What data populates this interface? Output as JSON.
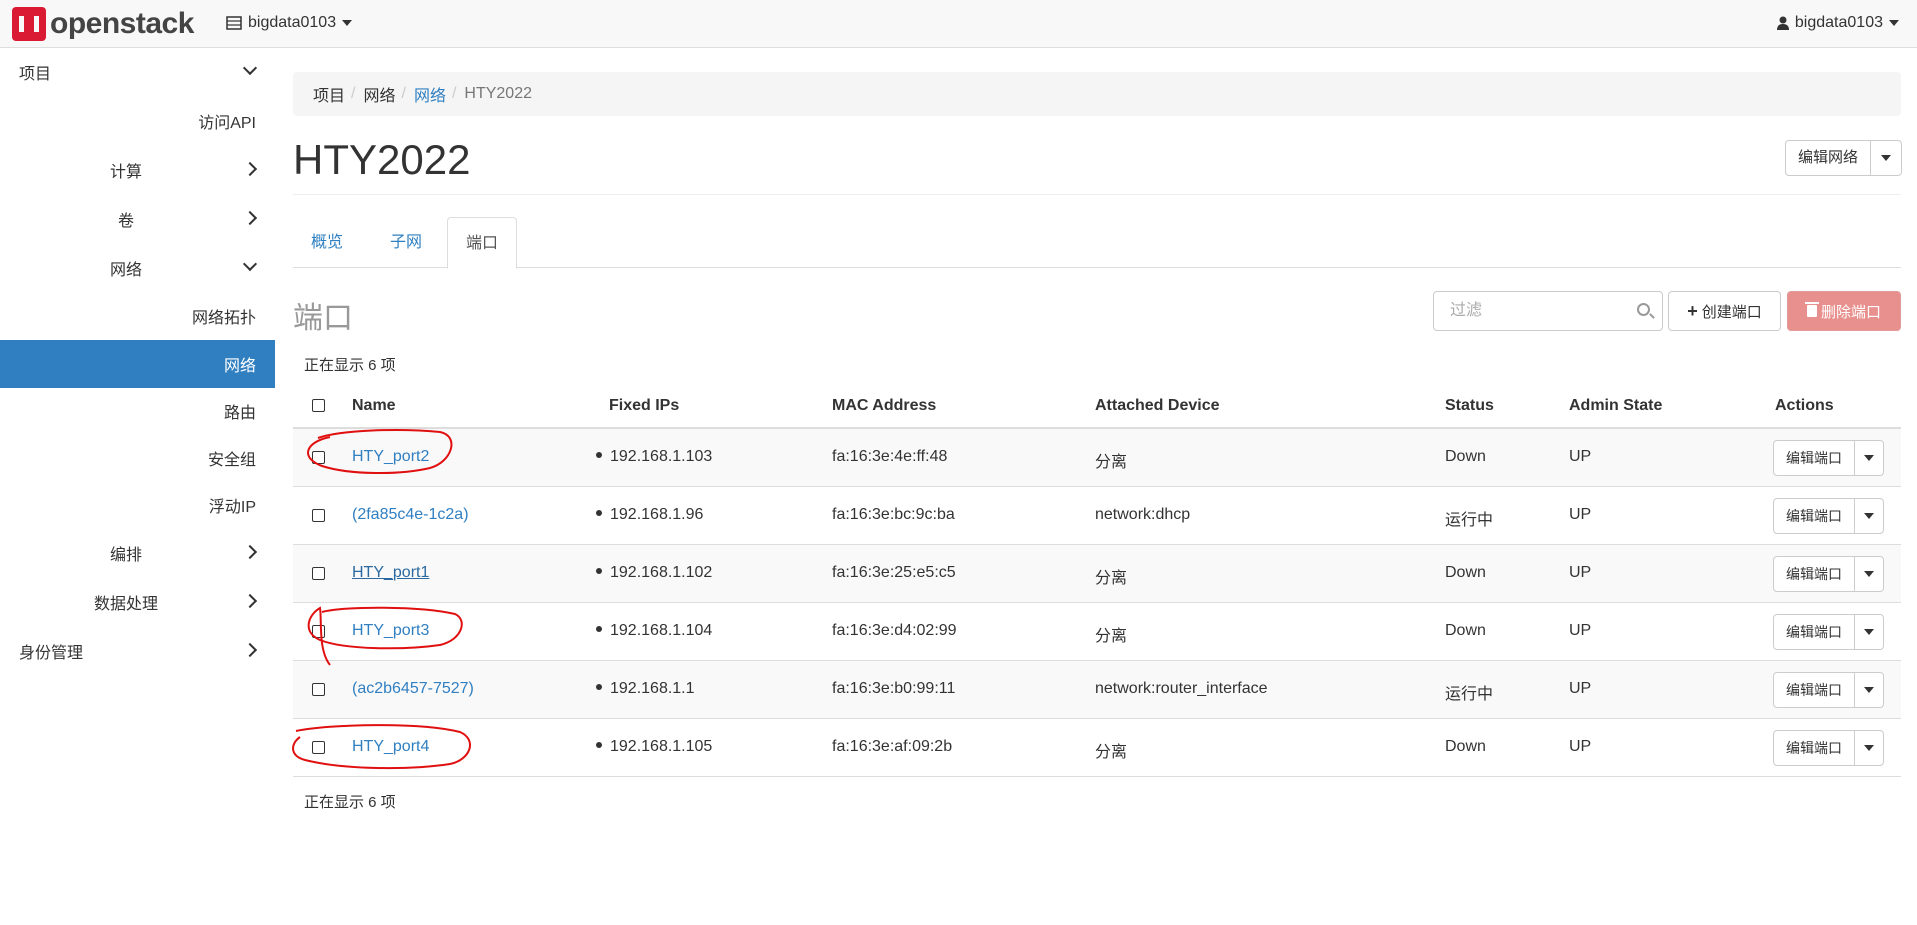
{
  "topbar": {
    "brand": "openstack",
    "project_selector": "bigdata0103",
    "user_menu": "bigdata0103"
  },
  "sidebar": {
    "items": [
      {
        "label": "项目"
      },
      {
        "label": "访问API"
      },
      {
        "label": "计算"
      },
      {
        "label": "卷"
      },
      {
        "label": "网络"
      },
      {
        "label": "网络拓扑"
      },
      {
        "label": "网络"
      },
      {
        "label": "路由"
      },
      {
        "label": "安全组"
      },
      {
        "label": "浮动IP"
      },
      {
        "label": "编排"
      },
      {
        "label": "数据处理"
      },
      {
        "label": "身份管理"
      }
    ]
  },
  "breadcrumb": {
    "items": [
      "项目",
      "网络",
      "网络",
      "HTY2022"
    ],
    "separator": "/"
  },
  "page": {
    "title": "HTY2022",
    "edit_button": "编辑网络"
  },
  "tabs": [
    "概览",
    "子网",
    "端口"
  ],
  "ports": {
    "section_title": "端口",
    "filter_placeholder": "过滤",
    "create_button": "创建端口",
    "delete_button": "删除端口",
    "count_text": "正在显示 6 项",
    "columns": [
      "Name",
      "Fixed IPs",
      "MAC Address",
      "Attached Device",
      "Status",
      "Admin State",
      "Actions"
    ],
    "rows": [
      {
        "name": "HTY_port2",
        "ip": "192.168.1.103",
        "mac": "fa:16:3e:4e:ff:48",
        "device": "分离",
        "status": "Down",
        "admin": "UP",
        "action": "编辑端口"
      },
      {
        "name": "(2fa85c4e-1c2a)",
        "ip": "192.168.1.96",
        "mac": "fa:16:3e:bc:9c:ba",
        "device": "network:dhcp",
        "status": "运行中",
        "admin": "UP",
        "action": "编辑端口"
      },
      {
        "name": "HTY_port1",
        "ip": "192.168.1.102",
        "mac": "fa:16:3e:25:e5:c5",
        "device": "分离",
        "status": "Down",
        "admin": "UP",
        "action": "编辑端口"
      },
      {
        "name": "HTY_port3",
        "ip": "192.168.1.104",
        "mac": "fa:16:3e:d4:02:99",
        "device": "分离",
        "status": "Down",
        "admin": "UP",
        "action": "编辑端口"
      },
      {
        "name": "(ac2b6457-7527)",
        "ip": "192.168.1.1",
        "mac": "fa:16:3e:b0:99:11",
        "device": "network:router_interface",
        "status": "运行中",
        "admin": "UP",
        "action": "编辑端口"
      },
      {
        "name": "HTY_port4",
        "ip": "192.168.1.105",
        "mac": "fa:16:3e:af:09:2b",
        "device": "分离",
        "status": "Down",
        "admin": "UP",
        "action": "编辑端口"
      }
    ]
  },
  "colors": {
    "accent": "#2f7fc1",
    "brand": "#da1a32",
    "danger": "#e8908e",
    "annotation": "#e01010"
  }
}
